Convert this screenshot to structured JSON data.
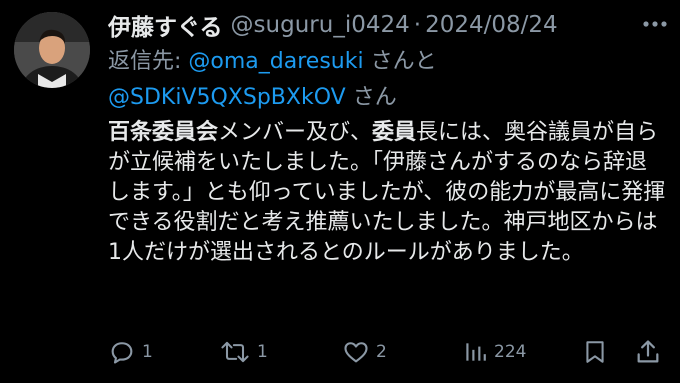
{
  "tweet": {
    "display_name": "伊藤すぐる",
    "handle": "@suguru_i0424",
    "separator": "·",
    "date": "2024/08/24",
    "reply_prefix": "返信先: ",
    "mention_1": "@oma_daresuki",
    "reply_and": " さんと",
    "mention_2": "@SDKiV5QXSpBXkOV",
    "reply_suffix": " さん",
    "body_bold_1": "百条委員会",
    "body_text_1": "メンバー及び、",
    "body_bold_2": "委員",
    "body_text_2": "長には、奥谷議員が自らが立候補をいたしました。「伊藤さんがするのなら辞退します。」とも仰っていましたが、彼の能力が最高に発揮できる役割だと考え推薦いたしました。神戸地区からは1人だけが選出されるとのルールがありました。"
  },
  "actions": {
    "reply_count": "1",
    "retweet_count": "1",
    "like_count": "2",
    "views_count": "224"
  },
  "colors": {
    "background": "#000000",
    "text_primary": "#e7e9ea",
    "text_secondary": "#8b98a5",
    "link": "#1d9bf0"
  },
  "icons": {
    "reply": "speech-bubble-icon",
    "retweet": "retweet-arrows-icon",
    "like": "heart-icon",
    "views": "bar-chart-icon",
    "bookmark": "bookmark-icon",
    "share": "share-upload-icon",
    "more": "ellipsis-icon"
  }
}
